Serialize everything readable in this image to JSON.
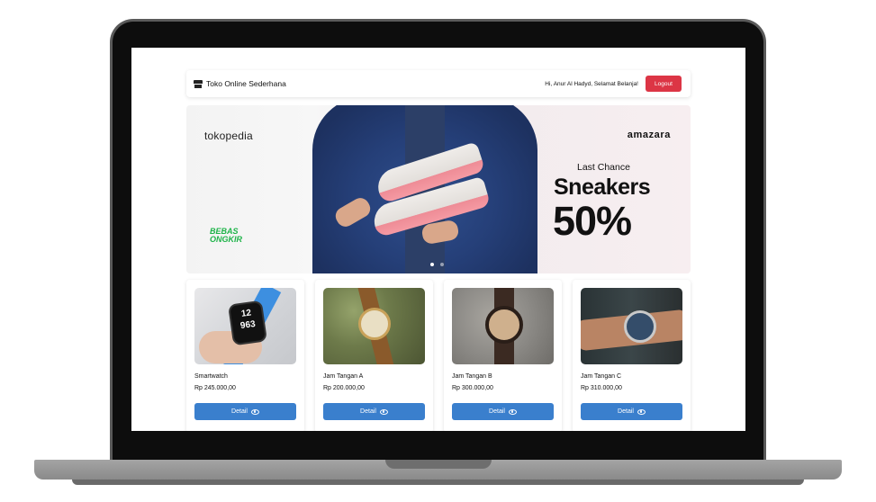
{
  "navbar": {
    "brand": "Toko Online Sederhana",
    "brand_icon": "store-icon",
    "greeting": "Hi, Anur Al Hadyd, Selamat Belanja!",
    "logout_label": "Logout",
    "logout_color": "#dc3545"
  },
  "banner": {
    "logo_left": "tokopedia",
    "logo_right": "amazara",
    "free_shipping_line1": "BEBAS",
    "free_shipping_line2": "ONGKIR",
    "tagline": "Last Chance",
    "headline": "Sneakers",
    "discount": "50%",
    "slide_count": 2,
    "active_slide": 1
  },
  "products": [
    {
      "name": "Smartwatch",
      "price": "Rp 245.000,00",
      "button": "Detail",
      "watch_face": "12\n963"
    },
    {
      "name": "Jam Tangan A",
      "price": "Rp 200.000,00",
      "button": "Detail"
    },
    {
      "name": "Jam Tangan B",
      "price": "Rp 300.000,00",
      "button": "Detail"
    },
    {
      "name": "Jam Tangan C",
      "price": "Rp 310.000,00",
      "button": "Detail"
    }
  ],
  "colors": {
    "primary_button": "#3a7fcd",
    "free_shipping_green": "#1db348"
  }
}
